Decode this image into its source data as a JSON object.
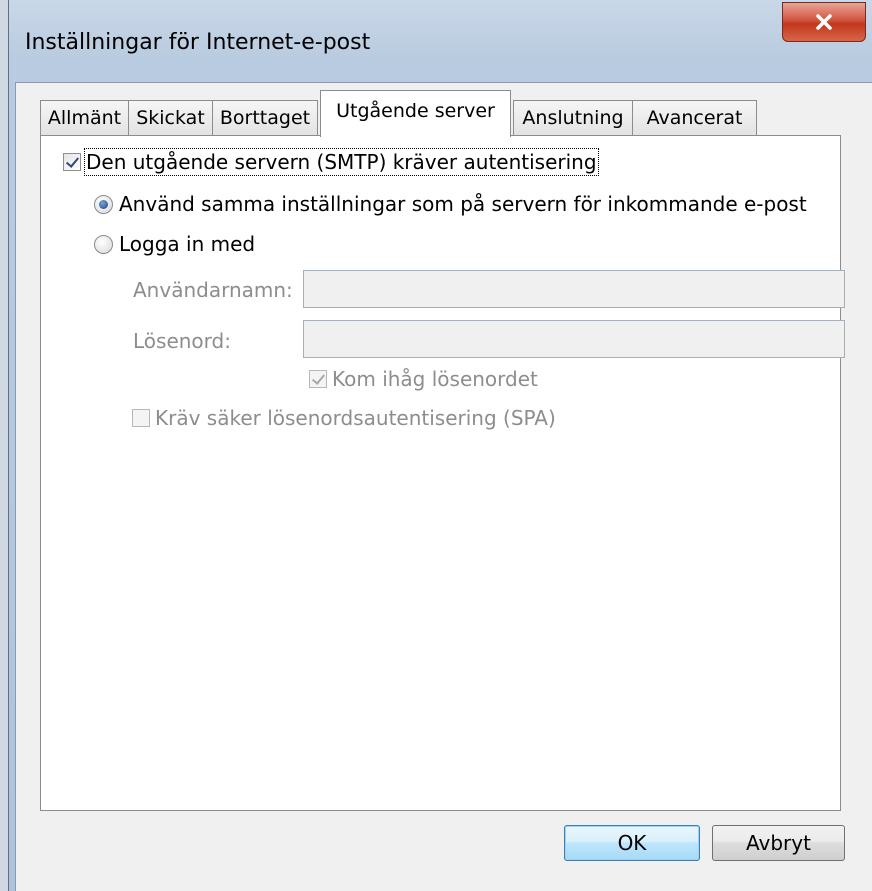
{
  "window": {
    "title": "Inställningar för Internet-e-post",
    "close_label": "×"
  },
  "tabs": [
    {
      "label": "Allmänt"
    },
    {
      "label": "Skickat"
    },
    {
      "label": "Borttaget"
    },
    {
      "label": "Utgående server"
    },
    {
      "label": "Anslutning"
    },
    {
      "label": "Avancerat"
    }
  ],
  "active_tab": "Utgående server",
  "smtp_auth": {
    "label": "Den utgående servern (SMTP) kräver autentisering",
    "checked": true
  },
  "auth_mode": {
    "same_settings": {
      "label": "Använd samma inställningar som på servern för inkommande e-post",
      "selected": true
    },
    "login_with": {
      "label": "Logga in med",
      "selected": false
    }
  },
  "credentials": {
    "username_label": "Användarnamn:",
    "username_value": "",
    "password_label": "Lösenord:",
    "password_value": "",
    "remember_label": "Kom ihåg lösenordet",
    "remember_checked": true,
    "spa_label": "Kräv säker lösenordsautentisering (SPA)",
    "spa_checked": false
  },
  "buttons": {
    "ok": "OK",
    "cancel": "Avbryt"
  },
  "colors": {
    "close_red": "#c0391f",
    "default_button_blue": "#3c7fb1",
    "disabled_text": "#8d8d8d"
  }
}
